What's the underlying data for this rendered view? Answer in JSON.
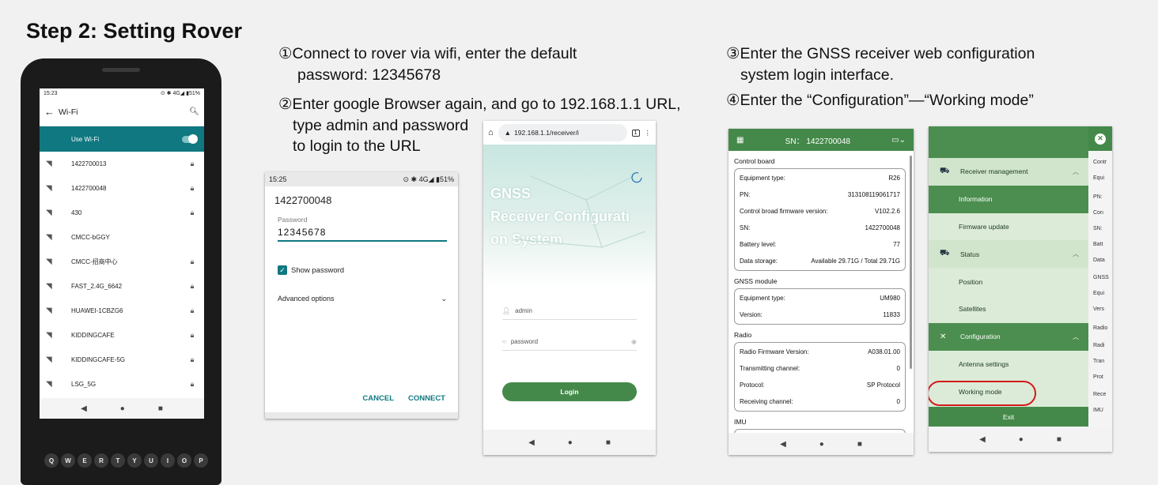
{
  "title": "Step 2: Setting Rover",
  "instructions": {
    "step1_line1": "①Connect to rover via wifi, enter the default",
    "step1_line2": "password: 12345678",
    "step2_line1": "②Enter google Browser again, and go to 192.168.1.1 URL,",
    "step2_line2": "type admin and password",
    "step2_line3": "to login to the URL",
    "step3_line1": "③Enter the GNSS receiver web configuration",
    "step3_line2": "system login interface.",
    "step4": "④Enter the “Configuration”—“Working mode”"
  },
  "phone": {
    "status_time": "15:23",
    "status_right": "⊙ ✱ 4G◢ ▮51%",
    "header": "Wi-Fi",
    "use_wifi": "Use Wi-Fi",
    "networks": [
      {
        "name": "1422700013",
        "locked": true
      },
      {
        "name": "1422700048",
        "locked": true
      },
      {
        "name": "430",
        "locked": true
      },
      {
        "name": "CMCC-bGGY",
        "locked": false
      },
      {
        "name": "CMCC-招商中心",
        "locked": true
      },
      {
        "name": "FAST_2.4G_6642",
        "locked": true
      },
      {
        "name": "HUAWEI-1CBZG6",
        "locked": true
      },
      {
        "name": "KIDDINGCAFE",
        "locked": true
      },
      {
        "name": "KIDDINGCAFE-5G",
        "locked": true
      },
      {
        "name": "LSG_5G",
        "locked": true
      }
    ],
    "keys": [
      "Q",
      "W",
      "E",
      "R",
      "T",
      "Y",
      "U",
      "I",
      "O",
      "P"
    ]
  },
  "password_dialog": {
    "status_time": "15:25",
    "status_right": "⊙ ✱ 4G◢ ▮51%",
    "network_name": "1422700048",
    "password_label": "Password",
    "password_value": "12345678",
    "show_password": "Show password",
    "advanced_options": "Advanced options",
    "cancel": "CANCEL",
    "connect": "CONNECT"
  },
  "browser": {
    "url": "192.168.1.1/receiver/i",
    "hero_title": [
      "GNSS",
      "Receiver Configurati",
      "on System"
    ],
    "username_placeholder": "admin",
    "password_placeholder": "password",
    "login": "Login"
  },
  "config": {
    "sn_header": "SN： 1422700048",
    "sections": [
      {
        "name": "Control board",
        "rows": [
          {
            "k": "Equipment type:",
            "v": "R26"
          },
          {
            "k": "PN:",
            "v": "313108119061717"
          },
          {
            "k": "Control broad firmware version:",
            "v": "V102.2.6"
          },
          {
            "k": "SN:",
            "v": "1422700048"
          },
          {
            "k": "Battery level:",
            "v": "77"
          },
          {
            "k": "Data storage:",
            "v": "Available 29.71G / Total 29.71G"
          }
        ]
      },
      {
        "name": "GNSS module",
        "rows": [
          {
            "k": "Equipment type:",
            "v": "UM980"
          },
          {
            "k": "Version:",
            "v": "11833"
          }
        ]
      },
      {
        "name": "Radio",
        "rows": [
          {
            "k": "Radio Firmware Version:",
            "v": "A038.01.00"
          },
          {
            "k": "Transmitting channel:",
            "v": "0"
          },
          {
            "k": "Protocol:",
            "v": "SP Protocol"
          },
          {
            "k": "Receiving channel:",
            "v": "0"
          }
        ]
      },
      {
        "name": "IMU",
        "rows": []
      }
    ]
  },
  "menu": {
    "items": [
      {
        "label": "Receiver management",
        "type": "group"
      },
      {
        "label": "Information",
        "type": "active"
      },
      {
        "label": "Firmware update",
        "type": "item"
      },
      {
        "label": "Status",
        "type": "group"
      },
      {
        "label": "Position",
        "type": "item"
      },
      {
        "label": "Satellites",
        "type": "item"
      },
      {
        "label": "Configuration",
        "type": "group-active"
      },
      {
        "label": "Antenna settings",
        "type": "item"
      },
      {
        "label": "Working mode",
        "type": "item"
      }
    ],
    "exit": "Exit",
    "side_labels": [
      "Contr",
      "Equi",
      "PN:",
      "Con",
      "SN:",
      "Batt",
      "Data",
      "GNSS",
      "Equi",
      "Vers",
      "Radio",
      "Radi",
      "Tran",
      "Prot",
      "Rece",
      "IMU"
    ]
  }
}
